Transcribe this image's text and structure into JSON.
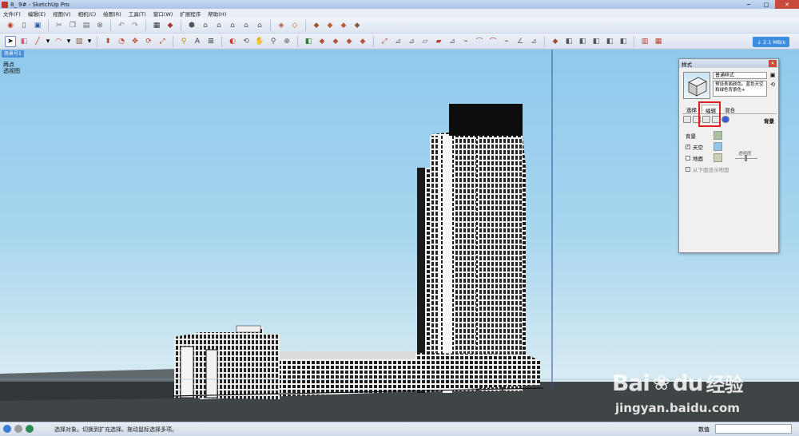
{
  "window": {
    "title": "8_ 9# - SketchUp Pro",
    "minimize": "─",
    "maximize": "□",
    "close": "✕"
  },
  "menu": [
    "文件(F)",
    "编辑(E)",
    "视图(V)",
    "相机(C)",
    "绘图(R)",
    "工具(T)",
    "窗口(W)",
    "扩展程序",
    "帮助(H)"
  ],
  "toolbar": {
    "network_speed": "↓ 2.1 MB/s"
  },
  "viewport": {
    "scene_tab": "场景号1",
    "camera_line1": "两点",
    "camera_line2": "透视图"
  },
  "styles_panel": {
    "title": "样式",
    "style_name": "普通样式",
    "description": "预设表面颜色。蓝色天空和绿色背景色+",
    "tabs": [
      "选择",
      "编辑",
      "混合"
    ],
    "active_tab": "编辑",
    "background_short": "背景",
    "section_label": "背景",
    "sky_label": "天空",
    "ground_label": "地面",
    "opacity_label": "透明度",
    "show_ground_from_below": "从下面显示地面",
    "colors": {
      "background": "#a9c39b",
      "sky": "#8ec9ec",
      "ground": "#cfcfb3"
    }
  },
  "watermark": {
    "brand": "Bai",
    "brand2": "du",
    "cn": "经验",
    "url": "jingyan.baidu.com"
  },
  "status": {
    "text": "选择对象。切换到扩充选择。拖动鼠标选择多项。",
    "measure_label": "数值",
    "measure_value": ""
  }
}
